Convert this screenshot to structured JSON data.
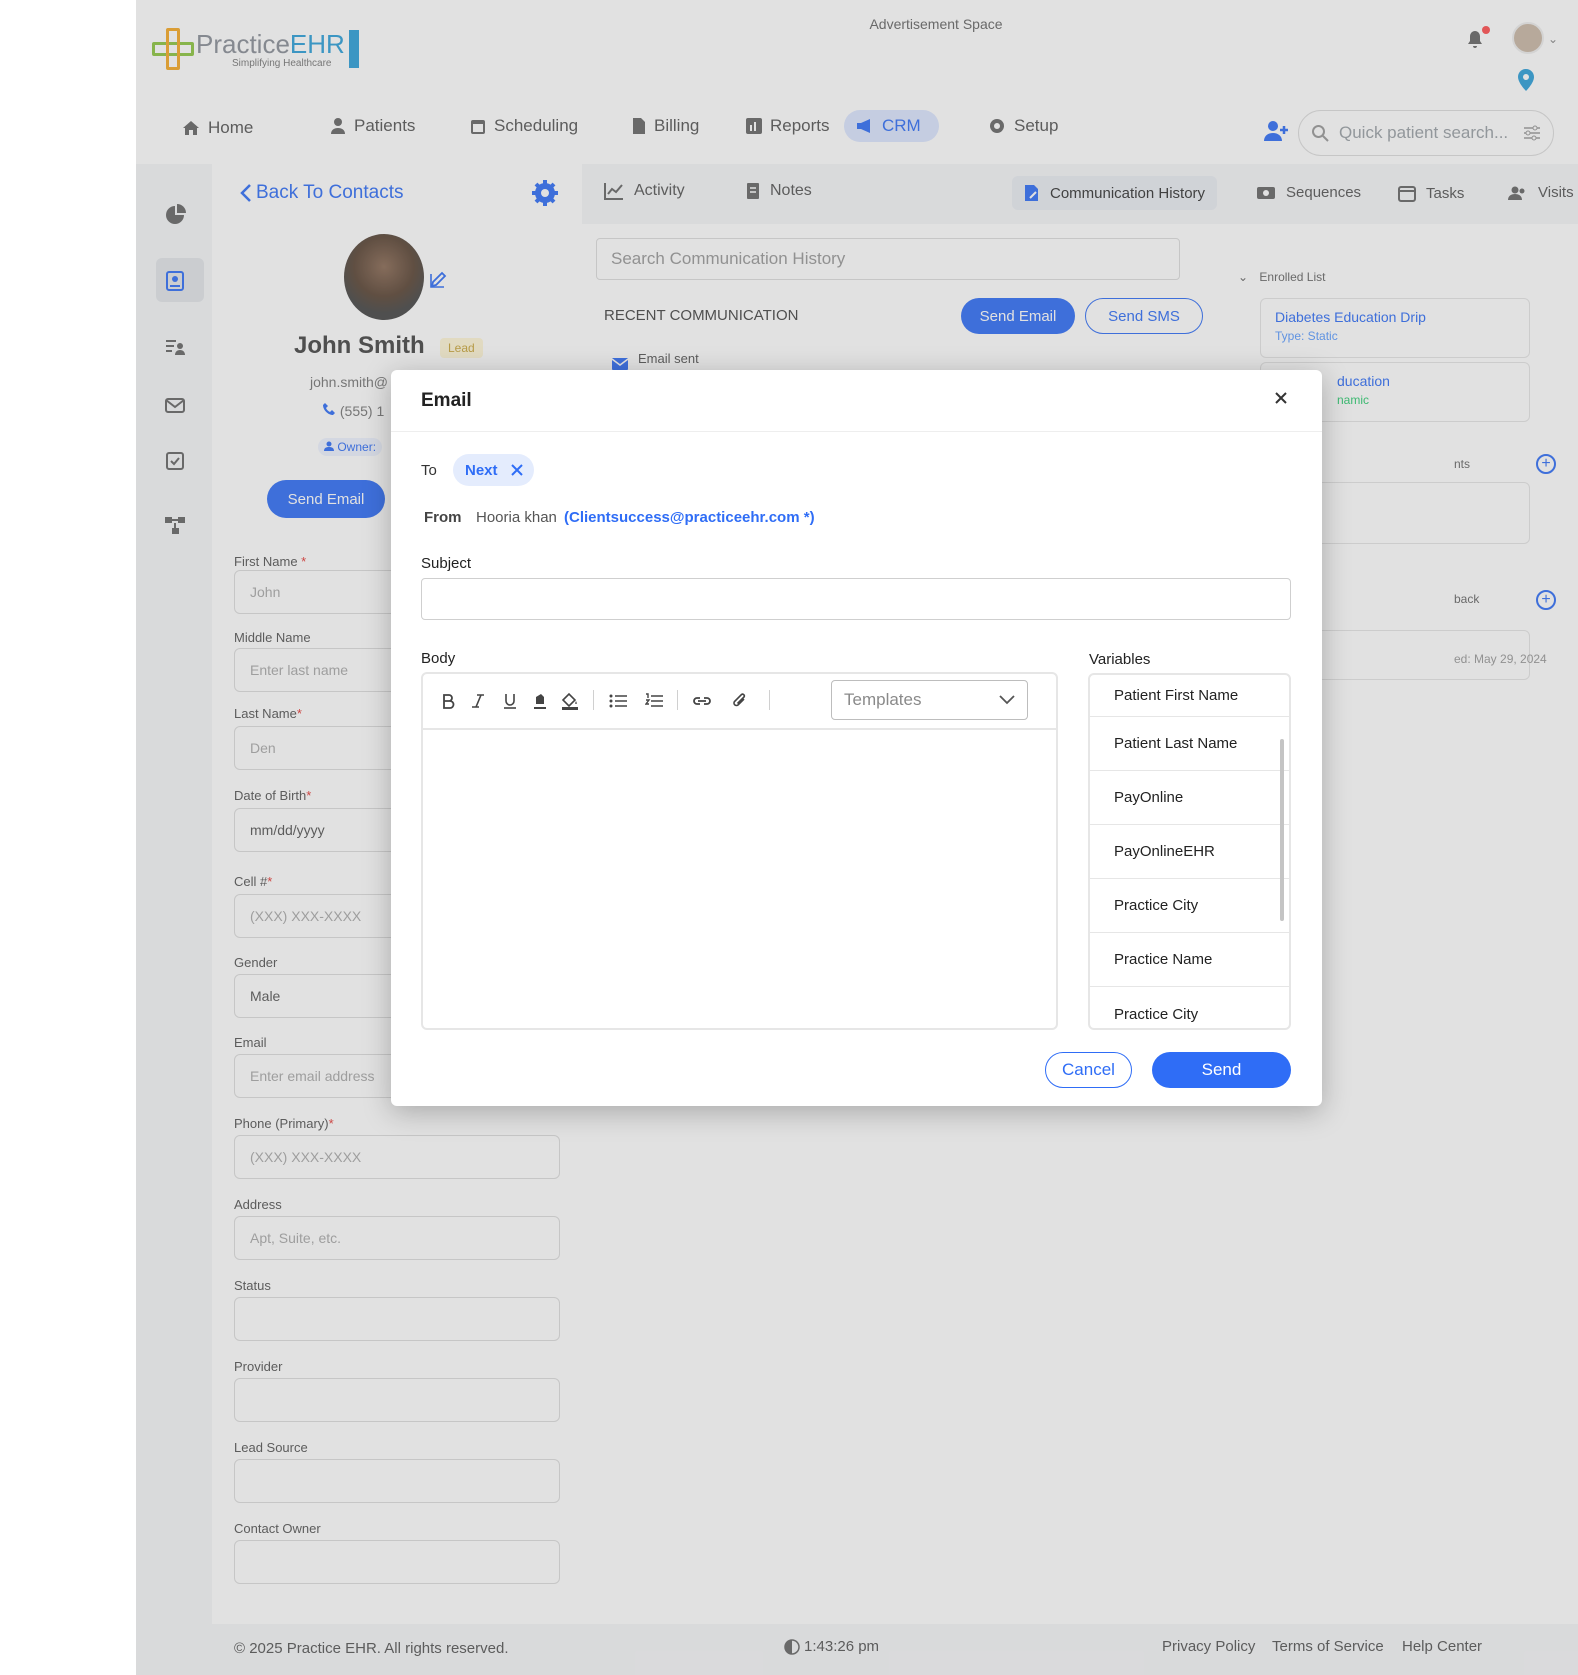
{
  "header": {
    "logo_name_a": "Practice",
    "logo_name_b": "EHR",
    "logo_tagline": "Simplifying Healthcare",
    "advertisement": "Advertisement Space"
  },
  "nav": {
    "items": [
      {
        "label": "Home",
        "icon": "home-icon"
      },
      {
        "label": "Patients",
        "icon": "patient-icon"
      },
      {
        "label": "Scheduling",
        "icon": "calendar-icon"
      },
      {
        "label": "Billing",
        "icon": "billing-icon"
      },
      {
        "label": "Reports",
        "icon": "reports-icon"
      },
      {
        "label": "CRM",
        "icon": "megaphone-icon",
        "active": true
      },
      {
        "label": "Setup",
        "icon": "gear-icon"
      }
    ],
    "search_placeholder": "Quick patient search..."
  },
  "contact": {
    "back_label": "Back To Contacts",
    "name": "John Smith",
    "badge": "Lead",
    "email": "john.smith@",
    "phone": "(555) 1",
    "owner": "Owner:",
    "send_email_label": "Send Email"
  },
  "form": {
    "fields": [
      {
        "label": "First Name",
        "required": " *",
        "value": "John"
      },
      {
        "label": "Middle Name",
        "required": "",
        "value": "Enter last name"
      },
      {
        "label": "Last Name",
        "required": "*",
        "value": "Den"
      },
      {
        "label": "Date of Birth",
        "required": "*",
        "value": "mm/dd/yyyy"
      },
      {
        "label": "Cell #",
        "required": "*",
        "value": "(XXX) XXX-XXXX"
      },
      {
        "label": "Gender",
        "required": "",
        "value": "Male"
      },
      {
        "label": "Email",
        "required": "",
        "value": "Enter email address"
      },
      {
        "label": "Phone (Primary)",
        "required": "*",
        "value": "(XXX) XXX-XXXX"
      },
      {
        "label": "Address",
        "required": "",
        "value": "Apt, Suite, etc."
      },
      {
        "label": "Status",
        "required": "",
        "value": ""
      },
      {
        "label": "Provider",
        "required": "",
        "value": ""
      },
      {
        "label": "Lead Source",
        "required": "",
        "value": ""
      },
      {
        "label": "Contact Owner",
        "required": "",
        "value": ""
      }
    ]
  },
  "tabs": {
    "items": [
      {
        "label": "Activity"
      },
      {
        "label": "Notes"
      },
      {
        "label": "Communication History",
        "active": true
      },
      {
        "label": "Sequences"
      },
      {
        "label": "Tasks"
      },
      {
        "label": "Visits"
      }
    ]
  },
  "comm": {
    "search_placeholder": "Search Communication History",
    "recent_title": "RECENT COMMUNICATION",
    "send_email": "Send Email",
    "send_sms": "Send SMS",
    "email_sent": "Email sent"
  },
  "right": {
    "enrolled_title": "Enrolled List",
    "seq1_name": "Diabetes Education Drip",
    "seq1_type": "Type: Static",
    "seq2_name": "ducation",
    "seq2_type": "namic",
    "sec_a": "nts",
    "sec_b": "back",
    "date_text": "ed:  May 29, 2024"
  },
  "footer": {
    "copyright": "© 2025 Practice EHR. All rights reserved.",
    "time": "1:43:26 pm",
    "links": [
      "Privacy Policy",
      "Terms of Service",
      "Help Center"
    ]
  },
  "modal": {
    "title": "Email",
    "to_label": "To",
    "to_chip": "Next",
    "from_label": "From",
    "from_name": "Hooria khan",
    "from_email": "(Clientsuccess@practiceehr.com  *)",
    "subject_label": "Subject",
    "subject_value": "",
    "body_label": "Body",
    "templates_placeholder": "Templates",
    "variables_label": "Variables",
    "variables": [
      "Patient First Name",
      "Patient Last Name",
      "PayOnline",
      "PayOnlineEHR",
      "Practice City",
      "Practice Name",
      "Practice City"
    ],
    "cancel_label": "Cancel",
    "send_label": "Send"
  },
  "colors": {
    "accent": "#2f6df6",
    "chip_bg": "#e4ecfd",
    "overlay": "rgba(120,120,120,0.22)"
  }
}
